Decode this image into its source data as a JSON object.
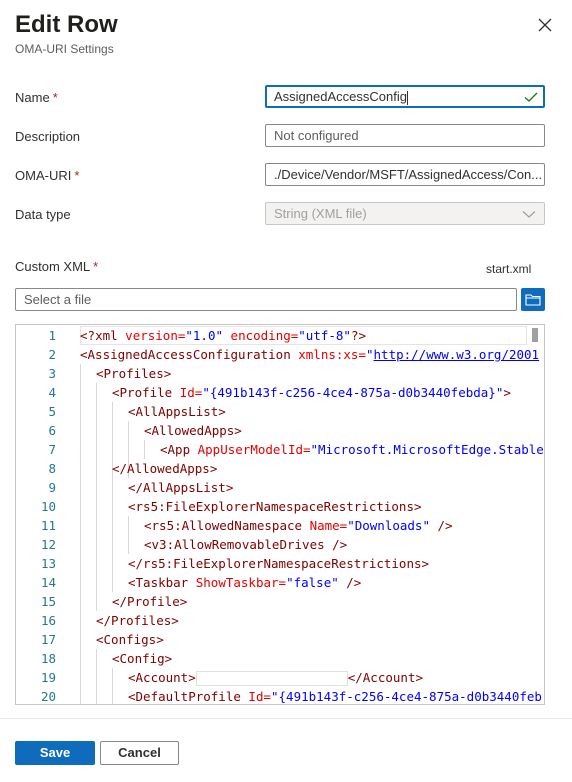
{
  "panel": {
    "title": "Edit Row",
    "subtitle": "OMA-URI Settings"
  },
  "form": {
    "name": {
      "label": "Name",
      "required": "*",
      "value": "AssignedAccessConfig"
    },
    "description": {
      "label": "Description",
      "placeholder": "Not configured"
    },
    "oma_uri": {
      "label": "OMA-URI",
      "required": "*",
      "value": "./Device/Vendor/MSFT/AssignedAccess/Con..."
    },
    "data_type": {
      "label": "Data type",
      "value": "String (XML file)"
    },
    "custom_xml": {
      "label": "Custom XML",
      "required": "*",
      "file_name": "start.xml",
      "file_placeholder": "Select a file"
    }
  },
  "editor": {
    "line_numbers": [
      "1",
      "2",
      "3",
      "4",
      "5",
      "6",
      "7",
      "8",
      "9",
      "10",
      "11",
      "12",
      "13",
      "14",
      "15",
      "16",
      "17",
      "18",
      "19",
      "20"
    ],
    "tokens": {
      "l1a": "<?",
      "l1b": "xml",
      "l1c": " version=",
      "l1d": "\"1.0\"",
      "l1e": " encoding=",
      "l1f": "\"utf-8\"",
      "l1g": "?>",
      "l2a": "<AssignedAccessConfiguration",
      "l2b": " xmlns:xs=",
      "l2c": "\"",
      "l2d": "http://www.w3.org/2001",
      "l3a": "<Profiles>",
      "l4a": "<Profile",
      "l4b": " Id=",
      "l4c": "\"{491b143f-c256-4ce4-875a-d0b3440febda}\"",
      "l4d": ">",
      "l5a": "<AllAppsList>",
      "l6a": "<AllowedApps>",
      "l7a": "<App",
      "l7b": " AppUserModelId=",
      "l7c": "\"Microsoft.MicrosoftEdge.Stable",
      "l8a": "</AllowedApps>",
      "l9a": "</AllAppsList>",
      "l10a": "<rs5:FileExplorerNamespaceRestrictions>",
      "l11a": "<rs5:AllowedNamespace",
      "l11b": " Name=",
      "l11c": "\"Downloads\"",
      "l11d": " />",
      "l12a": "<v3:AllowRemovableDrives />",
      "l13a": "</rs5:FileExplorerNamespaceRestrictions>",
      "l14a": "<Taskbar",
      "l14b": " ShowTaskbar=",
      "l14c": "\"false\"",
      "l14d": " />",
      "l15a": "</Profile>",
      "l16a": "</Profiles>",
      "l17a": "<Configs>",
      "l18a": "<Config>",
      "l19a": "<Account>",
      "l19b": "</Account>",
      "l20a": "<DefaultProfile",
      "l20b": " Id=",
      "l20c": "\"{491b143f-c256-4ce4-875a-d0b3440feb"
    }
  },
  "footer": {
    "save_label": "Save",
    "cancel_label": "Cancel"
  },
  "colors": {
    "accent": "#0f6cbd",
    "required": "#a4262c",
    "success": "#107c10"
  }
}
